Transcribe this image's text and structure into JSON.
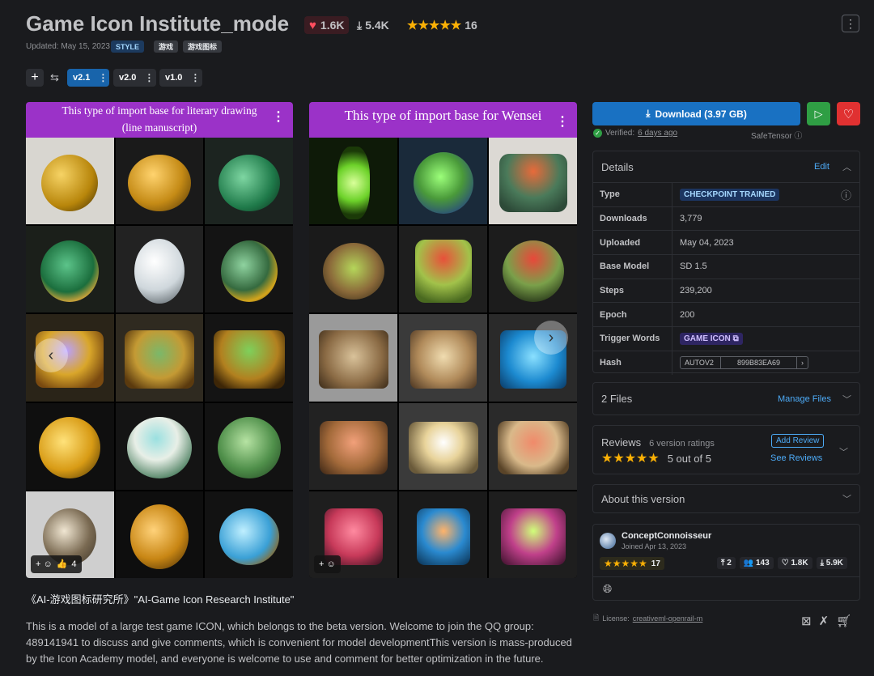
{
  "header": {
    "title": "Game Icon Institute_mode",
    "likes": "1.6K",
    "downloads": "5.4K",
    "rating_count": "16",
    "updated": "Updated: May 15, 2023",
    "badges": [
      "STYLE",
      "游戏",
      "游戏图标"
    ]
  },
  "versions": {
    "items": [
      "v2.1",
      "v2.0",
      "v1.0"
    ],
    "active": "v2.1"
  },
  "gallery": {
    "left_caption_1": "This type of import base for literary drawing",
    "left_caption_2": "(line manuscript)",
    "right_caption": "This type of import base for Wensei",
    "left_reaction_count": "4"
  },
  "description": {
    "title": "《AI-游戏图标研究所》\"AI-Game Icon Research Institute\"",
    "body": "This is a model of a large test game ICON, which belongs to the beta version. Welcome to join the QQ group: 489141941 to discuss and give comments, which is convenient for model developmentThis version is mass-produced by the Icon Academy model, and everyone is welcome to use and comment for better optimization in the future."
  },
  "actions": {
    "download_label": "Download (3.97 GB)",
    "verified_label": "Verified:",
    "verified_when": "6 days ago",
    "safetensor": "SafeTensor"
  },
  "details": {
    "heading": "Details",
    "edit_label": "Edit",
    "rows": [
      {
        "key": "Type",
        "value": "CHECKPOINT TRAINED"
      },
      {
        "key": "Downloads",
        "value": "3,779"
      },
      {
        "key": "Uploaded",
        "value": "May 04, 2023"
      },
      {
        "key": "Base Model",
        "value": "SD 1.5"
      },
      {
        "key": "Steps",
        "value": "239,200"
      },
      {
        "key": "Epoch",
        "value": "200"
      },
      {
        "key": "Trigger Words",
        "value": "GAME ICON"
      },
      {
        "key": "Hash",
        "value": "AUTOV2",
        "hash": "899B83EA69"
      }
    ]
  },
  "files": {
    "label": "2 Files",
    "manage": "Manage Files"
  },
  "reviews": {
    "label": "Reviews",
    "ratings": "6 version ratings",
    "score": "5 out of 5",
    "add": "Add Review",
    "see": "See Reviews"
  },
  "about": {
    "label": "About this version"
  },
  "creator": {
    "name": "ConceptConnoisseur",
    "joined": "Joined Apr 13, 2023",
    "rating_count": "17",
    "uploads": "2",
    "followers": "143",
    "likes": "1.8K",
    "downloads": "5.9K"
  },
  "license": {
    "label": "License:",
    "value": "creativeml-openrail-m"
  },
  "colors": {
    "accent": "#1971c2",
    "purple_banner": "#9b32c8",
    "bg": "#1a1b1e"
  }
}
